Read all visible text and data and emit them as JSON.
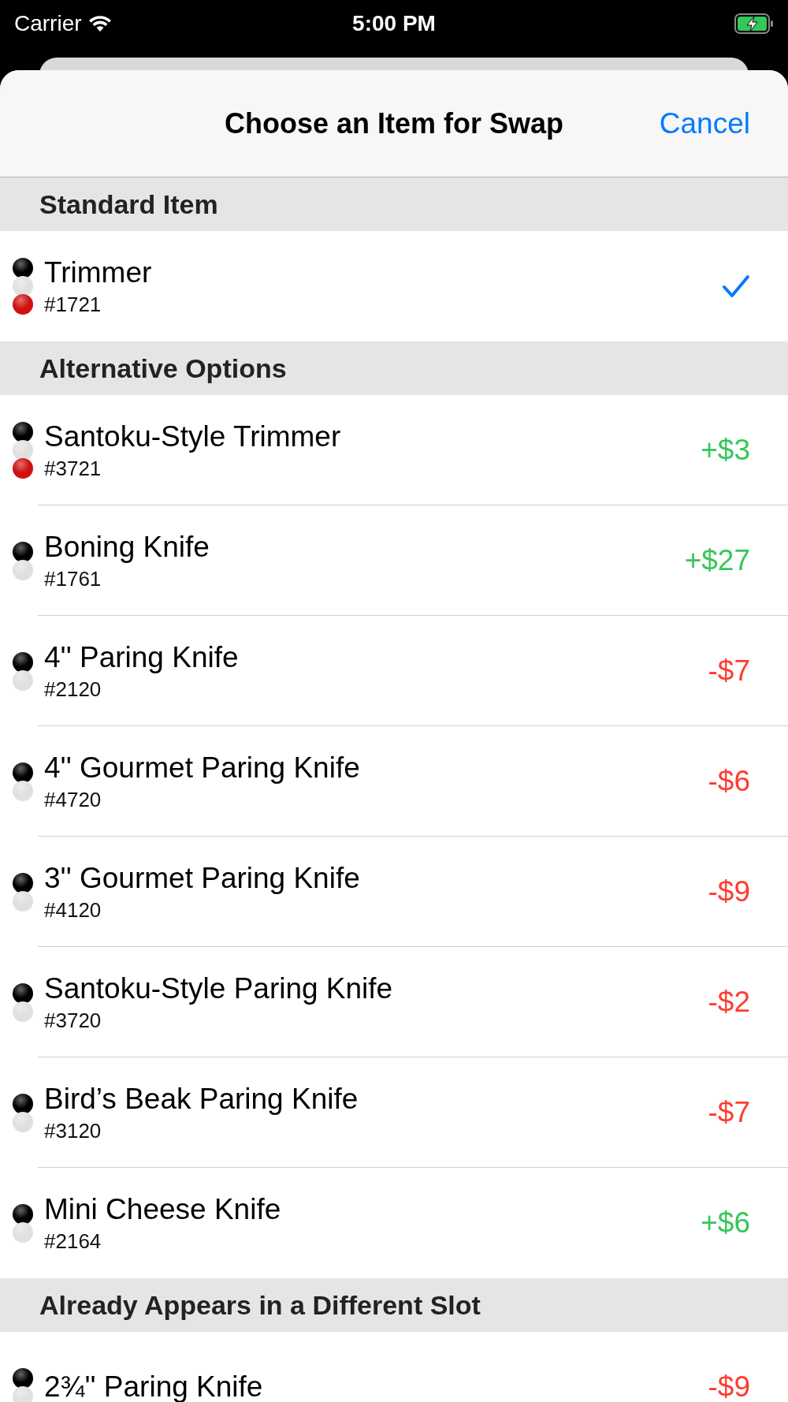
{
  "status_bar": {
    "carrier": "Carrier",
    "time": "5:00 PM",
    "charging": true
  },
  "nav": {
    "title": "Choose an Item for Swap",
    "cancel": "Cancel"
  },
  "sections": [
    {
      "header": "Standard Item",
      "items": [
        {
          "name": "Trimmer",
          "sku": "#1721",
          "selected": true,
          "dots": [
            {
              "color": "#000000"
            },
            {
              "color": "#e0e0e0"
            },
            {
              "color": "#d01010"
            }
          ]
        }
      ]
    },
    {
      "header": "Alternative Options",
      "items": [
        {
          "name": "Santoku-Style Trimmer",
          "sku": "#3721",
          "selected": false,
          "price": "+$3",
          "kind": "surcharge",
          "dots": [
            {
              "color": "#000000"
            },
            {
              "color": "#e0e0e0"
            },
            {
              "color": "#d01010"
            }
          ]
        },
        {
          "name": "Boning Knife",
          "sku": "#1761",
          "selected": false,
          "price": "+$27",
          "kind": "surcharge",
          "dots": [
            {
              "color": "#000000"
            },
            {
              "color": "#e0e0e0"
            }
          ]
        },
        {
          "name": "4'' Paring Knife",
          "sku": "#2120",
          "selected": false,
          "price": "-$7",
          "kind": "discount",
          "dots": [
            {
              "color": "#000000"
            },
            {
              "color": "#e0e0e0"
            }
          ]
        },
        {
          "name": "4'' Gourmet Paring Knife",
          "sku": "#4720",
          "selected": false,
          "price": "-$6",
          "kind": "discount",
          "dots": [
            {
              "color": "#000000"
            },
            {
              "color": "#e0e0e0"
            }
          ]
        },
        {
          "name": "3'' Gourmet Paring Knife",
          "sku": "#4120",
          "selected": false,
          "price": "-$9",
          "kind": "discount",
          "dots": [
            {
              "color": "#000000"
            },
            {
              "color": "#e0e0e0"
            }
          ]
        },
        {
          "name": "Santoku-Style Paring Knife",
          "sku": "#3720",
          "selected": false,
          "price": "-$2",
          "kind": "discount",
          "dots": [
            {
              "color": "#000000"
            },
            {
              "color": "#e0e0e0"
            }
          ]
        },
        {
          "name": "Bird’s Beak Paring Knife",
          "sku": "#3120",
          "selected": false,
          "price": "-$7",
          "kind": "discount",
          "dots": [
            {
              "color": "#000000"
            },
            {
              "color": "#e0e0e0"
            }
          ]
        },
        {
          "name": "Mini Cheese Knife",
          "sku": "#2164",
          "selected": false,
          "price": "+$6",
          "kind": "surcharge",
          "dots": [
            {
              "color": "#000000"
            },
            {
              "color": "#e0e0e0"
            }
          ]
        }
      ]
    },
    {
      "header": "Already Appears in a Different Slot",
      "items": [
        {
          "name": "2¾'' Paring Knife",
          "selected": false,
          "price": "-$9",
          "kind": "discount",
          "dots": [
            {
              "color": "#000000"
            },
            {
              "color": "#e0e0e0"
            }
          ]
        }
      ]
    }
  ]
}
